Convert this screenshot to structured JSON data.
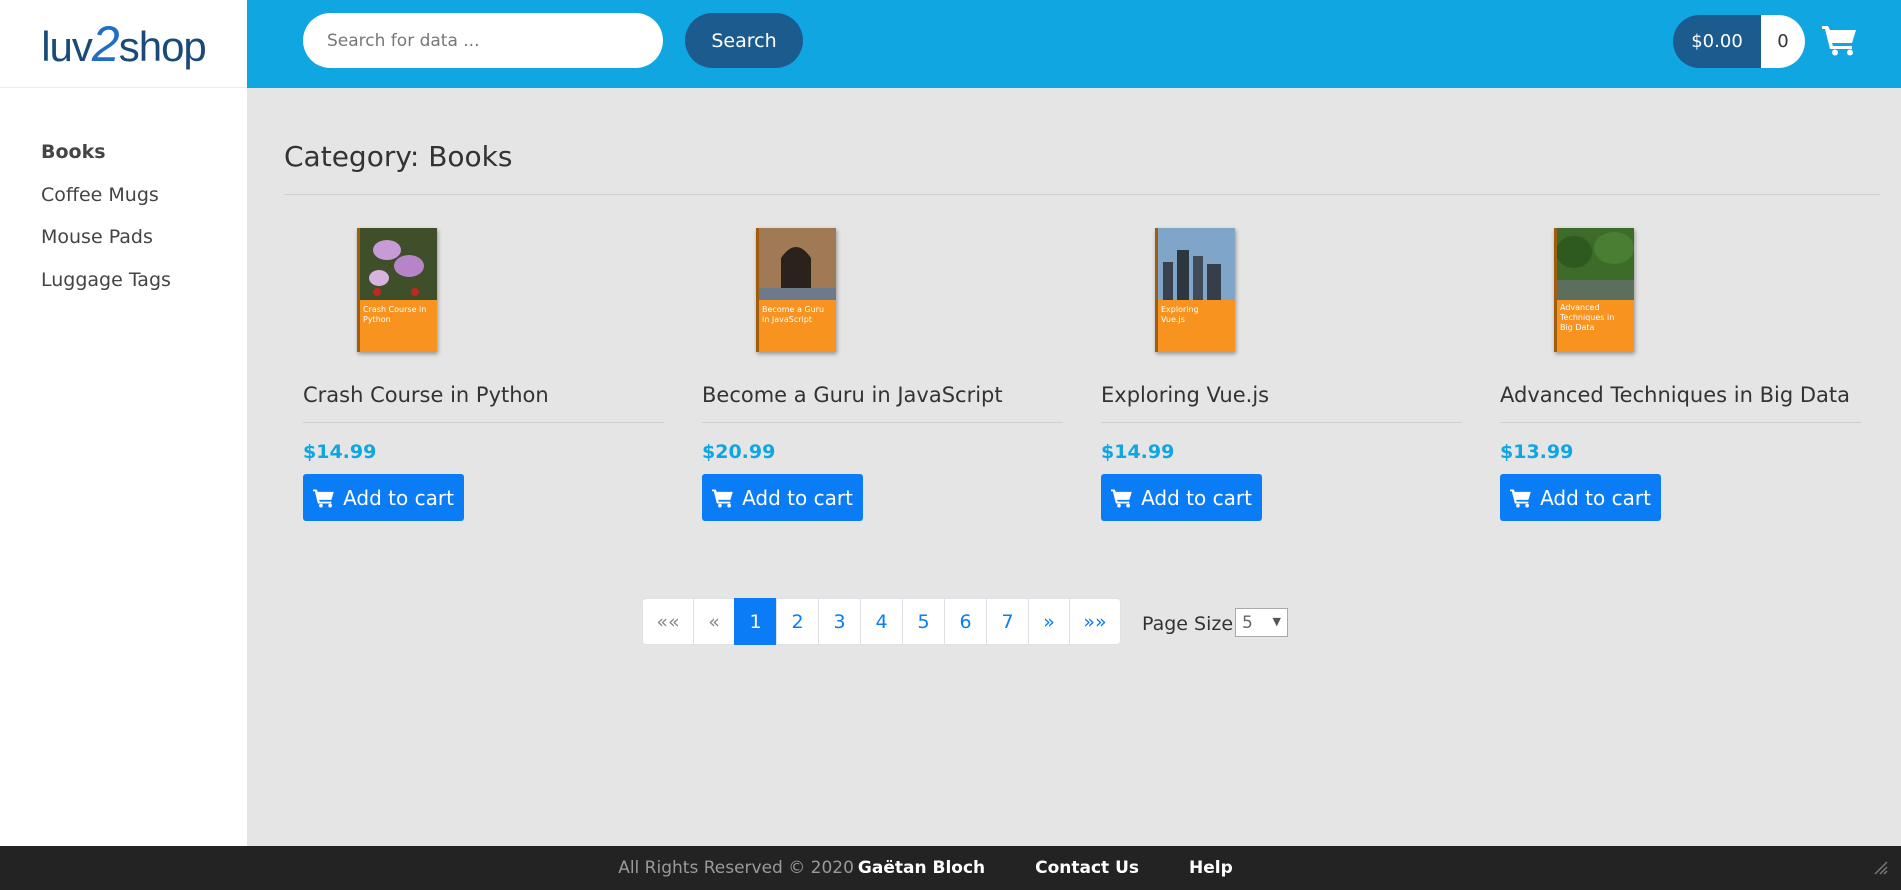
{
  "brand": {
    "logo_left": "luv",
    "logo_two": "2",
    "logo_right": "shop"
  },
  "sidebar": {
    "categories": [
      {
        "label": "Books",
        "active": true
      },
      {
        "label": "Coffee Mugs",
        "active": false
      },
      {
        "label": "Mouse Pads",
        "active": false
      },
      {
        "label": "Luggage Tags",
        "active": false
      }
    ]
  },
  "header": {
    "search_placeholder": "Search for data ...",
    "search_label": "Search",
    "cart_total": "$0.00",
    "cart_quantity": "0"
  },
  "main": {
    "title": "Category: Books",
    "products": [
      {
        "name": "Crash Course in Python",
        "price": "$14.99",
        "cover_text": "Crash Course in Python",
        "cover_art": "flowers"
      },
      {
        "name": "Become a Guru in JavaScript",
        "price": "$20.99",
        "cover_text": "Become a Guru in JavaScript",
        "cover_art": "archway"
      },
      {
        "name": "Exploring Vue.js",
        "price": "$14.99",
        "cover_text": "Exploring Vue.js",
        "cover_art": "city-skyline"
      },
      {
        "name": "Advanced Techniques in Big Data",
        "price": "$13.99",
        "cover_text": "Advanced Techniques in Big Data",
        "cover_art": "river-trees"
      }
    ],
    "add_to_cart_label": "Add to cart"
  },
  "pagination": {
    "first": "««",
    "prev": "«",
    "pages": [
      "1",
      "2",
      "3",
      "4",
      "5",
      "6",
      "7"
    ],
    "current": "1",
    "next": "»",
    "last": "»»",
    "page_size_label": "Page Size",
    "page_size_value": "5"
  },
  "footer": {
    "rights": "All Rights Reserved © 2020",
    "author": "Gaëtan Bloch",
    "links": [
      "Contact Us",
      "Help"
    ]
  },
  "colors": {
    "header_bg": "#0fa6e2",
    "dark_blue": "#1c5b8d",
    "primary": "#0a7cf5",
    "price": "#0fa6e2",
    "cover_orange": "#f7931e",
    "footer_bg": "#232323"
  },
  "icons": [
    "shopping-cart-icon",
    "resize-handle-icon"
  ]
}
